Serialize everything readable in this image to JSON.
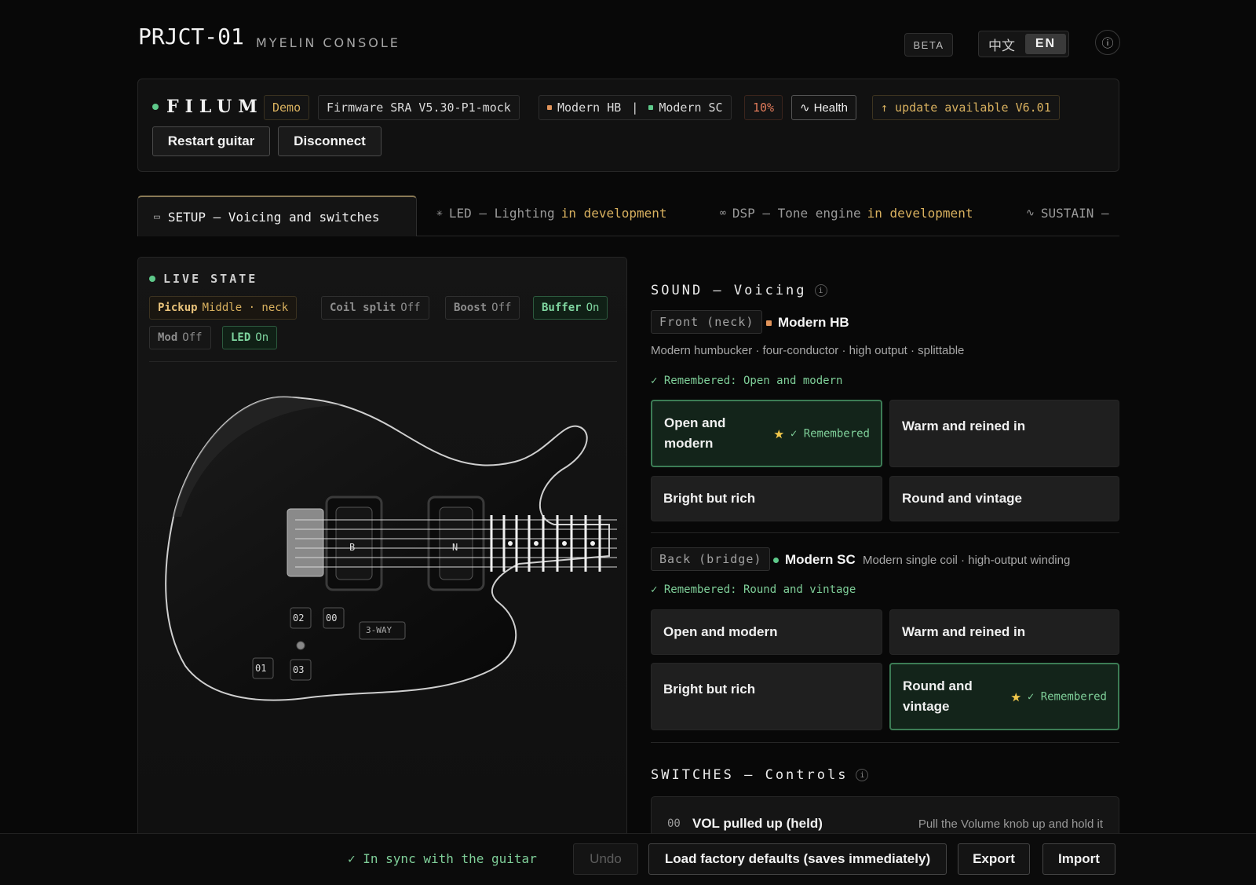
{
  "header": {
    "brand": "PRJCT-01",
    "subtitle": "MYELIN CONSOLE",
    "beta": "BETA",
    "lang_zh": "中文",
    "lang_en": "EN",
    "info_icon": "ⓘ"
  },
  "device": {
    "name": "FILUM",
    "status_color": "#5ec98a",
    "mode": "Demo",
    "firmware": "Firmware SRA V5.30-P1-mock",
    "pickup_front": "Modern HB",
    "pickup_separator": "|",
    "pickup_back": "Modern SC",
    "battery": "10%",
    "health_icon": "∿",
    "health": "Health",
    "update": "↑ update available V6.01",
    "restart": "Restart guitar",
    "disconnect": "Disconnect"
  },
  "tabs": [
    {
      "icon": "▭",
      "label": "SETUP — Voicing and switches",
      "status": ""
    },
    {
      "icon": "✳",
      "label": "LED — Lighting",
      "status": "in development"
    },
    {
      "icon": "∞",
      "label": "DSP — Tone engine",
      "status": "in development"
    },
    {
      "icon": "∿",
      "label": "SUSTAIN —",
      "status": ""
    }
  ],
  "live_state": {
    "title": "LIVE STATE",
    "chips": [
      {
        "key": "Pickup",
        "value": "Middle · neck"
      },
      {
        "key": "Coil split",
        "value": "Off"
      },
      {
        "key": "Boost",
        "value": "Off"
      },
      {
        "key": "Buffer",
        "value": "On"
      },
      {
        "key": "Mod",
        "value": "Off"
      },
      {
        "key": "LED",
        "value": "On"
      }
    ],
    "guitar": {
      "pickup_b": "B",
      "pickup_n": "N",
      "knob_02": "02",
      "knob_00": "00",
      "knob_01": "01",
      "knob_03": "03",
      "switch": "3-WAY"
    }
  },
  "sound": {
    "title": "SOUND — Voicing",
    "info": "i",
    "front": {
      "position": "Front (neck)",
      "pickup": "Modern HB",
      "color": "#e0935a",
      "description": "Modern humbucker · four-conductor · high output · splittable",
      "remembered": "✓ Remembered: Open and modern",
      "voicings": [
        {
          "label": "Open and modern",
          "selected": true,
          "tag": "✓ Remembered"
        },
        {
          "label": "Warm and reined in",
          "selected": false
        },
        {
          "label": "Bright but rich",
          "selected": false
        },
        {
          "label": "Round and vintage",
          "selected": false
        }
      ]
    },
    "back": {
      "position": "Back (bridge)",
      "pickup": "Modern SC",
      "color": "#5ec98a",
      "description": "Modern single coil · high-output winding",
      "remembered": "✓ Remembered: Round and vintage",
      "voicings": [
        {
          "label": "Open and modern",
          "selected": false
        },
        {
          "label": "Warm and reined in",
          "selected": false
        },
        {
          "label": "Bright but rich",
          "selected": false
        },
        {
          "label": "Round and vintage",
          "selected": true,
          "tag": "✓ Remembered"
        }
      ]
    }
  },
  "switches": {
    "title": "SWITCHES — Controls",
    "info": "i",
    "rows": [
      {
        "code": "00",
        "name": "VOL pulled up (held)",
        "description": "Pull the Volume knob up and hold it"
      }
    ]
  },
  "footer": {
    "sync": "✓ In sync with the guitar",
    "undo": "Undo",
    "factory": "Load factory defaults (saves immediately)",
    "export": "Export",
    "import": "Import"
  },
  "colors": {
    "accent_green": "#5ec98a",
    "accent_orange": "#e0935a",
    "dev_yellow": "#d9b15f",
    "battery_red": "#e07a5a"
  }
}
